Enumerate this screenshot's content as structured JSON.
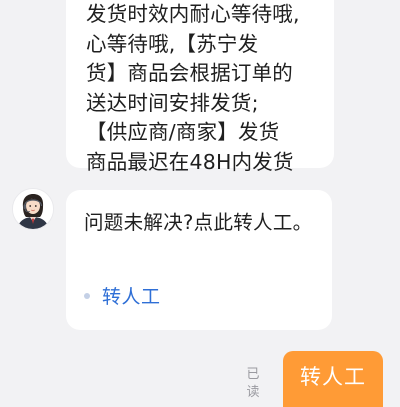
{
  "messages": {
    "notice_lines": [
      "发货时效内耐心等待哦,",
      "心等待哦,【苏宁发",
      "货】商品会根据订单的",
      "送达时间安排发货;",
      "【供应商/商家】发货",
      "商品最迟在48H内发货"
    ],
    "help_text": "问题未解决?点此转人工。",
    "transfer_link_label": "转人工",
    "avatar_icon": "customer-service-agent-avatar"
  },
  "user_message": {
    "label": "转人工",
    "read_status": "已读",
    "bubble_color": "#ff9b36"
  },
  "colors": {
    "link": "#2f6fd6",
    "background": "#f2f2f4"
  }
}
